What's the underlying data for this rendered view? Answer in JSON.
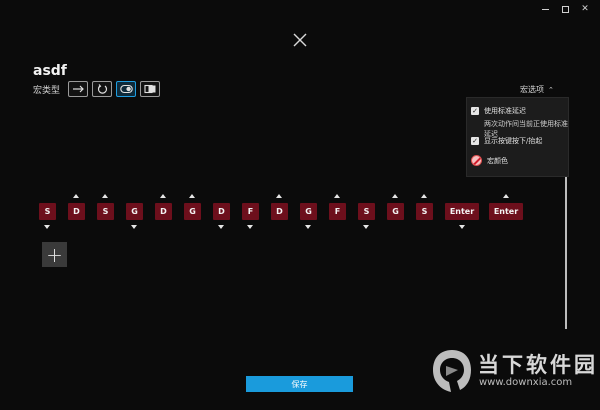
{
  "window": {
    "minimize_glyph": "",
    "maximize_glyph": "",
    "close_glyph": "✕"
  },
  "macro": {
    "name": "asdf",
    "type_label": "宏类型",
    "type_buttons": [
      {
        "icon": "arrow-right-icon",
        "active": false
      },
      {
        "icon": "repeat-icon",
        "active": false
      },
      {
        "icon": "toggle-icon",
        "active": true
      },
      {
        "icon": "sequence-icon",
        "active": false
      }
    ]
  },
  "options": {
    "dropdown_label": "宏选项",
    "use_standard_delay": "使用标准延迟",
    "delay_sub": "两次动作间当前正使用标准延迟",
    "show_press_release": "显示按键按下/抬起",
    "macro_color": "宏颜色"
  },
  "sequence": {
    "keys": [
      {
        "label": "S",
        "dir": "down"
      },
      {
        "label": "D",
        "dir": "up"
      },
      {
        "label": "S",
        "dir": "up"
      },
      {
        "label": "G",
        "dir": "down"
      },
      {
        "label": "D",
        "dir": "up"
      },
      {
        "label": "G",
        "dir": "up"
      },
      {
        "label": "D",
        "dir": "down"
      },
      {
        "label": "F",
        "dir": "down"
      },
      {
        "label": "D",
        "dir": "up"
      },
      {
        "label": "G",
        "dir": "down"
      },
      {
        "label": "F",
        "dir": "up"
      },
      {
        "label": "S",
        "dir": "down"
      },
      {
        "label": "G",
        "dir": "up"
      },
      {
        "label": "S",
        "dir": "up"
      },
      {
        "label": "Enter",
        "dir": "down"
      },
      {
        "label": "Enter",
        "dir": "up"
      }
    ],
    "add_label": "+"
  },
  "footer": {
    "save_label": "保存"
  },
  "watermark": {
    "title": "当下软件园",
    "url": "www.downxia.com"
  },
  "colors": {
    "key_bg": "#6d0f1c",
    "accent": "#1a9bdc"
  }
}
